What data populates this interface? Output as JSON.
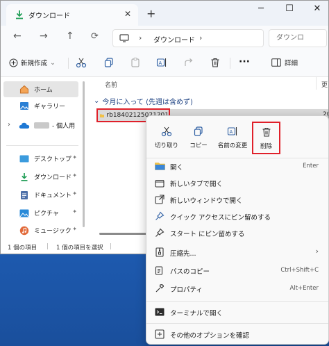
{
  "window": {
    "tab_title": "ダウンロード",
    "tab_close": "✕",
    "new_tab": "+",
    "minimize": "─",
    "maximize": "☐",
    "close": "✕"
  },
  "address": {
    "back": "←",
    "forward": "→",
    "up": "↑",
    "sep1": "›",
    "crumb": "ダウンロード",
    "sep2": "›",
    "search_placeholder": "ダウンロ"
  },
  "toolbar": {
    "new_label": "新規作成",
    "new_chevron": "⌄",
    "more": "···",
    "details_label": "詳細"
  },
  "sidebar": {
    "items": [
      {
        "label": "ホーム",
        "icon": "home-icon"
      },
      {
        "label": "ギャラリー",
        "icon": "gallery-icon"
      },
      {
        "label": "- 個人用",
        "icon": "onedrive-icon",
        "expander": "›"
      },
      {
        "label": "デスクトップ",
        "icon": "desktop-icon",
        "pin": "📌"
      },
      {
        "label": "ダウンロード",
        "icon": "download-icon",
        "pin": "📌"
      },
      {
        "label": "ドキュメント",
        "icon": "documents-icon",
        "pin": "📌"
      },
      {
        "label": "ピクチャ",
        "icon": "pictures-icon",
        "pin": "📌"
      },
      {
        "label": "ミュージック",
        "icon": "music-icon",
        "pin": "📌"
      }
    ]
  },
  "content": {
    "column_name": "名前",
    "column_date": "更",
    "group_chevron": "⌄",
    "group_label": "今月に入って (先週は含めず)",
    "file_name": "rb18402125021201",
    "file_date": "20"
  },
  "status": {
    "count": "1 個の項目",
    "divider1": "|",
    "selected": "1 個の項目を選択",
    "divider2": "|"
  },
  "context_menu": {
    "quick_actions": [
      {
        "label": "切り取り",
        "icon": "cut-icon"
      },
      {
        "label": "コピー",
        "icon": "copy-icon"
      },
      {
        "label": "名前の変更",
        "icon": "rename-icon"
      },
      {
        "label": "削除",
        "icon": "delete-icon"
      }
    ],
    "items": [
      {
        "label": "開く",
        "shortcut": "Enter",
        "icon": "folder-icon"
      },
      {
        "label": "新しいタブで開く",
        "shortcut": "",
        "icon": "new-tab-icon"
      },
      {
        "label": "新しいウィンドウで開く",
        "shortcut": "",
        "icon": "new-window-icon"
      },
      {
        "label": "クイック アクセスにピン留めする",
        "shortcut": "",
        "icon": "pin-icon"
      },
      {
        "label": "スタート にピン留めする",
        "shortcut": "",
        "icon": "pin-start-icon"
      },
      {
        "label": "圧縮先...",
        "shortcut": "›",
        "icon": "zip-icon"
      },
      {
        "label": "パスのコピー",
        "shortcut": "Ctrl+Shift+C",
        "icon": "copy-path-icon"
      },
      {
        "label": "プロパティ",
        "shortcut": "Alt+Enter",
        "icon": "properties-icon"
      },
      {
        "label": "ターミナルで開く",
        "shortcut": "",
        "icon": "terminal-icon"
      },
      {
        "label": "その他のオプションを確認",
        "shortcut": "",
        "icon": "more-options-icon"
      }
    ]
  },
  "colors": {
    "accent": "#0067c0",
    "highlight_border": "#e0202a",
    "folder": "#f5c342"
  }
}
